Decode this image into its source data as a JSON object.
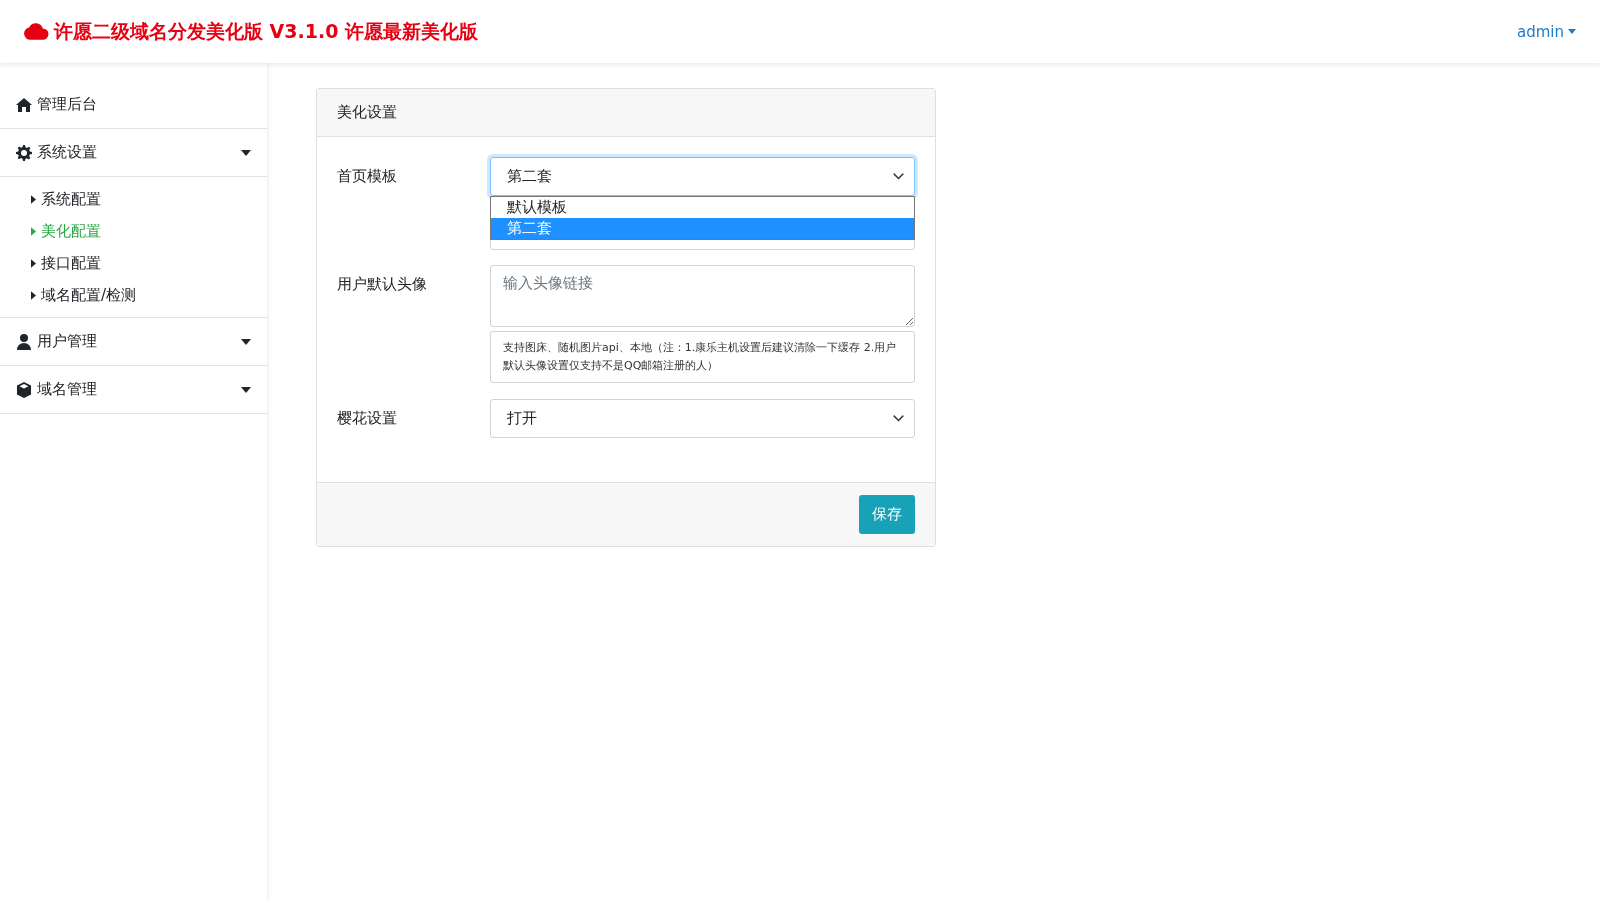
{
  "header": {
    "title": "许愿二级域名分发美化版 V3.1.0 许愿最新美化版",
    "user_menu": "admin"
  },
  "sidebar": {
    "items": [
      {
        "kind": "link",
        "label": "管理后台"
      },
      {
        "kind": "group",
        "label": "系统设置",
        "expanded": true,
        "children": [
          {
            "label": "系统配置",
            "selected": false
          },
          {
            "label": "美化配置",
            "selected": true
          },
          {
            "label": "接口配置",
            "selected": false
          },
          {
            "label": "域名配置/检测",
            "selected": false
          }
        ]
      },
      {
        "kind": "group",
        "label": "用户管理"
      },
      {
        "kind": "group",
        "label": "域名管理"
      }
    ]
  },
  "panel": {
    "title": "美化设置",
    "fields": [
      {
        "kind": "select",
        "label": "首页模板",
        "value": "第二套",
        "open": true,
        "options": [
          {
            "label": "默认模板",
            "selected": false
          },
          {
            "label": "第二套",
            "selected": true
          }
        ]
      },
      {
        "kind": "textarea",
        "label": "用户默认头像",
        "placeholder": "输入头像链接",
        "help": "支持图床、随机图片api、本地（注：1.康乐主机设置后建议清除一下缓存 2.用户默认头像设置仅支持不是QQ邮箱注册的人）"
      },
      {
        "kind": "select",
        "label": "樱花设置",
        "value": "打开",
        "open": false
      }
    ],
    "save_button": "保存"
  }
}
